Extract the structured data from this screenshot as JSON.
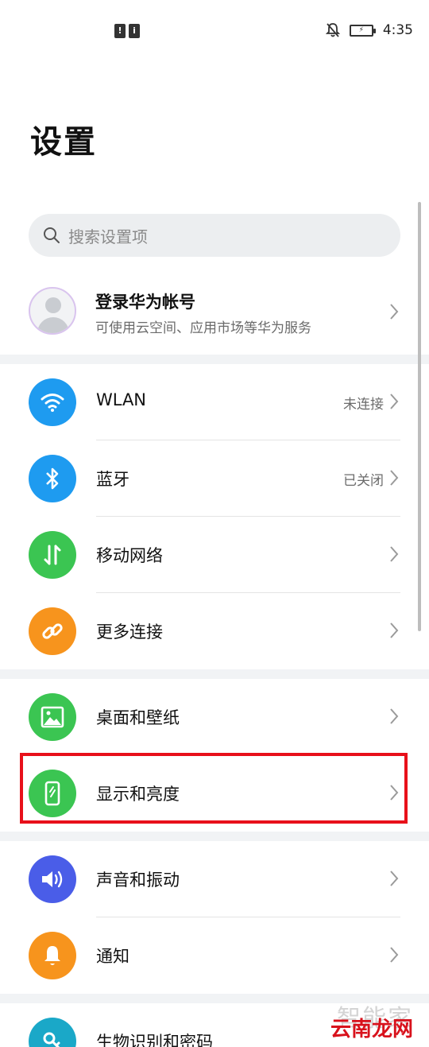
{
  "status_bar": {
    "time": "4:35"
  },
  "page": {
    "title": "设置"
  },
  "search": {
    "placeholder": "搜索设置项"
  },
  "account": {
    "title": "登录华为帐号",
    "subtitle": "可使用云空间、应用市场等华为服务"
  },
  "groups": [
    {
      "items": [
        {
          "label": "WLAN",
          "value": "未连接",
          "icon": "wifi-icon",
          "color": "#1e9bf0"
        },
        {
          "label": "蓝牙",
          "value": "已关闭",
          "icon": "bluetooth-icon",
          "color": "#1e9bf0"
        },
        {
          "label": "移动网络",
          "value": "",
          "icon": "mobile-data-icon",
          "color": "#3bc552"
        },
        {
          "label": "更多连接",
          "value": "",
          "icon": "link-icon",
          "color": "#f7941d"
        }
      ]
    },
    {
      "items": [
        {
          "label": "桌面和壁纸",
          "value": "",
          "icon": "wallpaper-icon",
          "color": "#3bc552"
        },
        {
          "label": "显示和亮度",
          "value": "",
          "icon": "display-icon",
          "color": "#3bc552"
        }
      ]
    },
    {
      "items": [
        {
          "label": "声音和振动",
          "value": "",
          "icon": "sound-icon",
          "color": "#4a5de8"
        },
        {
          "label": "通知",
          "value": "",
          "icon": "notification-bell-icon",
          "color": "#f7941d"
        }
      ]
    },
    {
      "items": [
        {
          "label": "生物识别和密码",
          "value": "",
          "icon": "key-icon",
          "color": "#1aa8c8"
        }
      ]
    }
  ],
  "highlight": {
    "target": "显示和亮度",
    "color": "#e8101a"
  },
  "watermark": {
    "top_text": "智能家",
    "bottom_text": "云南龙网"
  }
}
